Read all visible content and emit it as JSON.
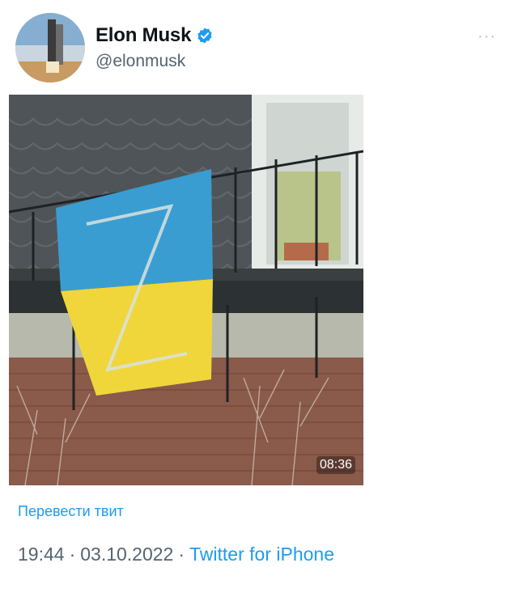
{
  "author": {
    "name": "Elon Musk",
    "handle": "@elonmusk"
  },
  "icons": {
    "verified": "verified-badge-icon",
    "more": "more-options-icon"
  },
  "more_label": "···",
  "media": {
    "timestamp": "08:36"
  },
  "translate_label": "Перевести твит",
  "meta": {
    "time": "19:44",
    "separator": "·",
    "date": "03.10.2022",
    "source": "Twitter for iPhone"
  },
  "colors": {
    "accent": "#1d9bf0",
    "secondary_text": "#536471",
    "flag_blue": "#3a9dd1",
    "flag_yellow": "#f0d63a"
  }
}
